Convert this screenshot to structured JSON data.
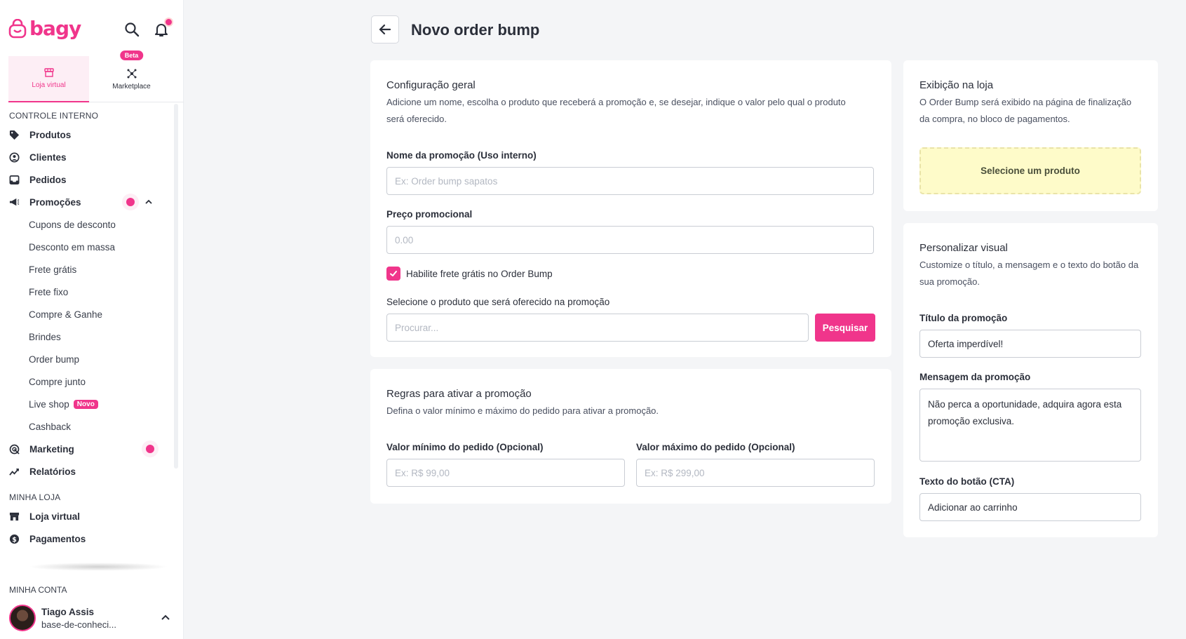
{
  "brand": {
    "name": "bagy"
  },
  "colors": {
    "accent": "#f0358b",
    "accent_soft": "#fdeef5",
    "preview_bg": "#fefbc9",
    "page_bg": "#f4f5f7"
  },
  "sidebar": {
    "tabs": [
      {
        "label": "Loja virtual",
        "icon": "store-icon",
        "active": true
      },
      {
        "label": "Marketplace",
        "icon": "network-icon",
        "badge": "Beta"
      }
    ],
    "sections": {
      "internal": "CONTROLE INTERNO",
      "store": "MINHA LOJA",
      "account": "MINHA CONTA"
    },
    "items": {
      "produtos": "Produtos",
      "clientes": "Clientes",
      "pedidos": "Pedidos",
      "promocoes": "Promoções",
      "marketing": "Marketing",
      "relatorios": "Relatórios",
      "loja_virtual": "Loja virtual",
      "pagamentos": "Pagamentos"
    },
    "promo_sub": [
      "Cupons de desconto",
      "Desconto em massa",
      "Frete grátis",
      "Frete fixo",
      "Compre & Ganhe",
      "Brindes",
      "Order bump",
      "Compre junto",
      "Live shop",
      "Cashback"
    ],
    "novo_badge": "Novo",
    "account": {
      "name": "Tiago Assis",
      "store": "base-de-conheci..."
    }
  },
  "header": {
    "title": "Novo order bump"
  },
  "general": {
    "title": "Configuração geral",
    "desc": "Adicione um nome, escolha o produto que receberá a promoção e, se desejar, indique o valor pelo qual o produto será oferecido.",
    "name_label": "Nome da promoção (Uso interno)",
    "name_placeholder": "Ex: Order bump sapatos",
    "price_label": "Preço promocional",
    "price_placeholder": "0.00",
    "free_shipping_label": "Habilite frete grátis no Order Bump",
    "free_shipping_checked": true,
    "product_label": "Selecione o produto que será oferecido na promoção",
    "product_placeholder": "Procurar...",
    "search_button": "Pesquisar"
  },
  "rules": {
    "title": "Regras para ativar a promoção",
    "desc": "Defina o valor mínimo e máximo do pedido para ativar a promoção.",
    "min_label": "Valor mínimo do pedido (Opcional)",
    "min_placeholder": "Ex: R$ 99,00",
    "max_label": "Valor máximo do pedido (Opcional)",
    "max_placeholder": "Ex: R$ 299,00"
  },
  "display": {
    "title": "Exibição na loja",
    "desc": "O Order Bump será exibido na página de finalização da compra, no bloco de pagamentos.",
    "preview_text": "Selecione um produto"
  },
  "visual": {
    "title": "Personalizar visual",
    "desc": "Customize o título, a mensagem e o texto do botão da sua promoção.",
    "title_label": "Título da promoção",
    "title_value": "Oferta imperdível!",
    "message_label": "Mensagem da promoção",
    "message_value": "Não perca a oportunidade, adquira agora esta promoção exclusiva.",
    "cta_label": "Texto do botão (CTA)",
    "cta_value": "Adicionar ao carrinho"
  }
}
